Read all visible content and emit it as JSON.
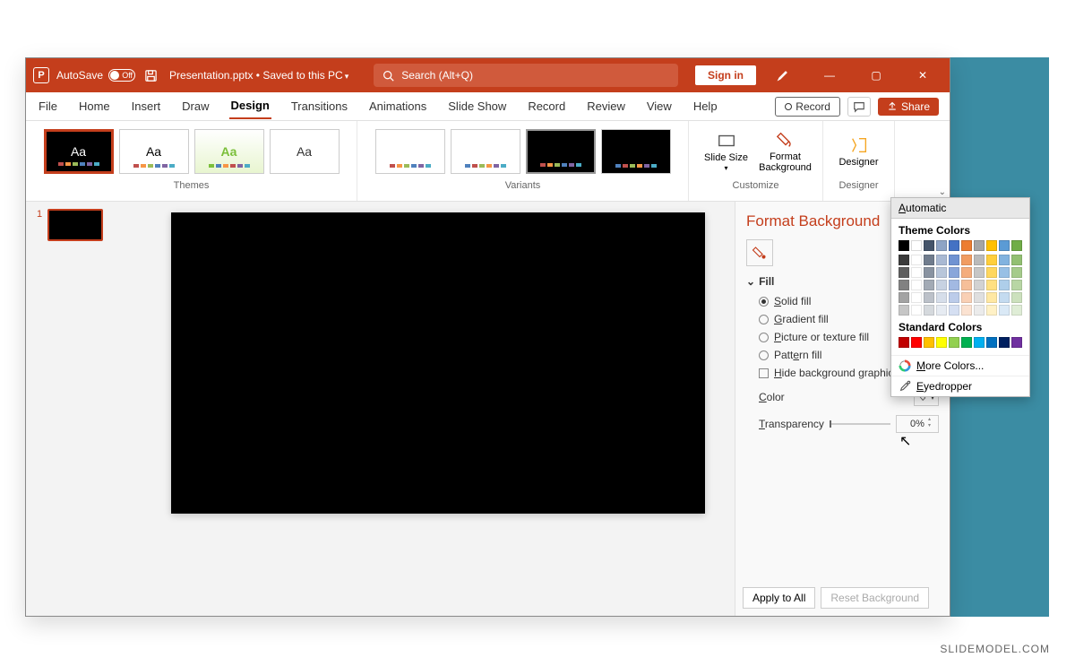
{
  "titlebar": {
    "autosave": "AutoSave",
    "autosave_state": "Off",
    "filename": "Presentation.pptx",
    "saved_status": "Saved to this PC",
    "search_placeholder": "Search (Alt+Q)",
    "signin": "Sign in"
  },
  "menu": {
    "tabs": [
      "File",
      "Home",
      "Insert",
      "Draw",
      "Design",
      "Transitions",
      "Animations",
      "Slide Show",
      "Record",
      "Review",
      "View",
      "Help"
    ],
    "active": "Design",
    "record": "Record",
    "share": "Share"
  },
  "ribbon": {
    "themes_label": "Themes",
    "variants_label": "Variants",
    "customize_label": "Customize",
    "designer_label": "Designer",
    "slide_size": "Slide Size",
    "format_bg": "Format Background",
    "designer": "Designer"
  },
  "thumbs": {
    "slide1_num": "1"
  },
  "panel": {
    "title": "Format Background",
    "fill": "Fill",
    "solid": "Solid fill",
    "gradient": "Gradient fill",
    "picture": "Picture or texture fill",
    "pattern": "Pattern fill",
    "hide": "Hide background graphics",
    "color": "Color",
    "transparency": "Transparency",
    "transparency_val": "0%",
    "apply_all": "Apply to All",
    "reset": "Reset Background"
  },
  "color_popup": {
    "automatic": "Automatic",
    "theme": "Theme Colors",
    "standard": "Standard Colors",
    "more": "More Colors...",
    "eyedropper": "Eyedropper",
    "theme_row": [
      "#000000",
      "#ffffff",
      "#44546a",
      "#8ea4c5",
      "#4472c4",
      "#ed7d31",
      "#a5a5a5",
      "#ffc000",
      "#5b9bd5",
      "#70ad47"
    ],
    "standard_row": [
      "#c00000",
      "#ff0000",
      "#ffc000",
      "#ffff00",
      "#92d050",
      "#00b050",
      "#00b0f0",
      "#0070c0",
      "#002060",
      "#7030a0"
    ]
  },
  "brand": "SLIDEMODEL.COM"
}
